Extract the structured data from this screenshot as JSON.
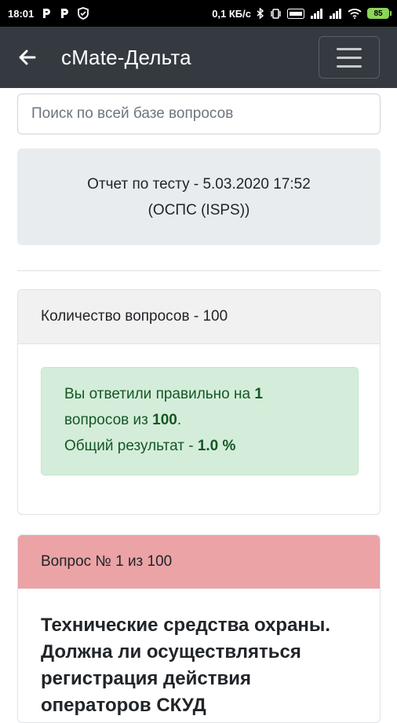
{
  "status_bar": {
    "time": "18:01",
    "speed": "0,1 КБ/с",
    "battery": "85"
  },
  "app_bar": {
    "title": "cMate-Дельта"
  },
  "search": {
    "placeholder": "Поиск по всей базе вопросов"
  },
  "report": {
    "line1": "Отчет по тесту - 5.03.2020 17:52",
    "line2": "(ОСПС (ISPS))"
  },
  "summary": {
    "header": "Количество вопросов - 100",
    "answered_prefix": "Вы ответили правильно на",
    "correct_count": "1",
    "questions_from": "вопросов из",
    "total": "100",
    "period": ".",
    "result_label": "Общий результат -",
    "result_value": "1.0 %"
  },
  "question": {
    "header": "Вопрос № 1 из 100",
    "text": "Технические средства охраны. Должна ли осуществляться регистрация действия операторов СКУД"
  }
}
